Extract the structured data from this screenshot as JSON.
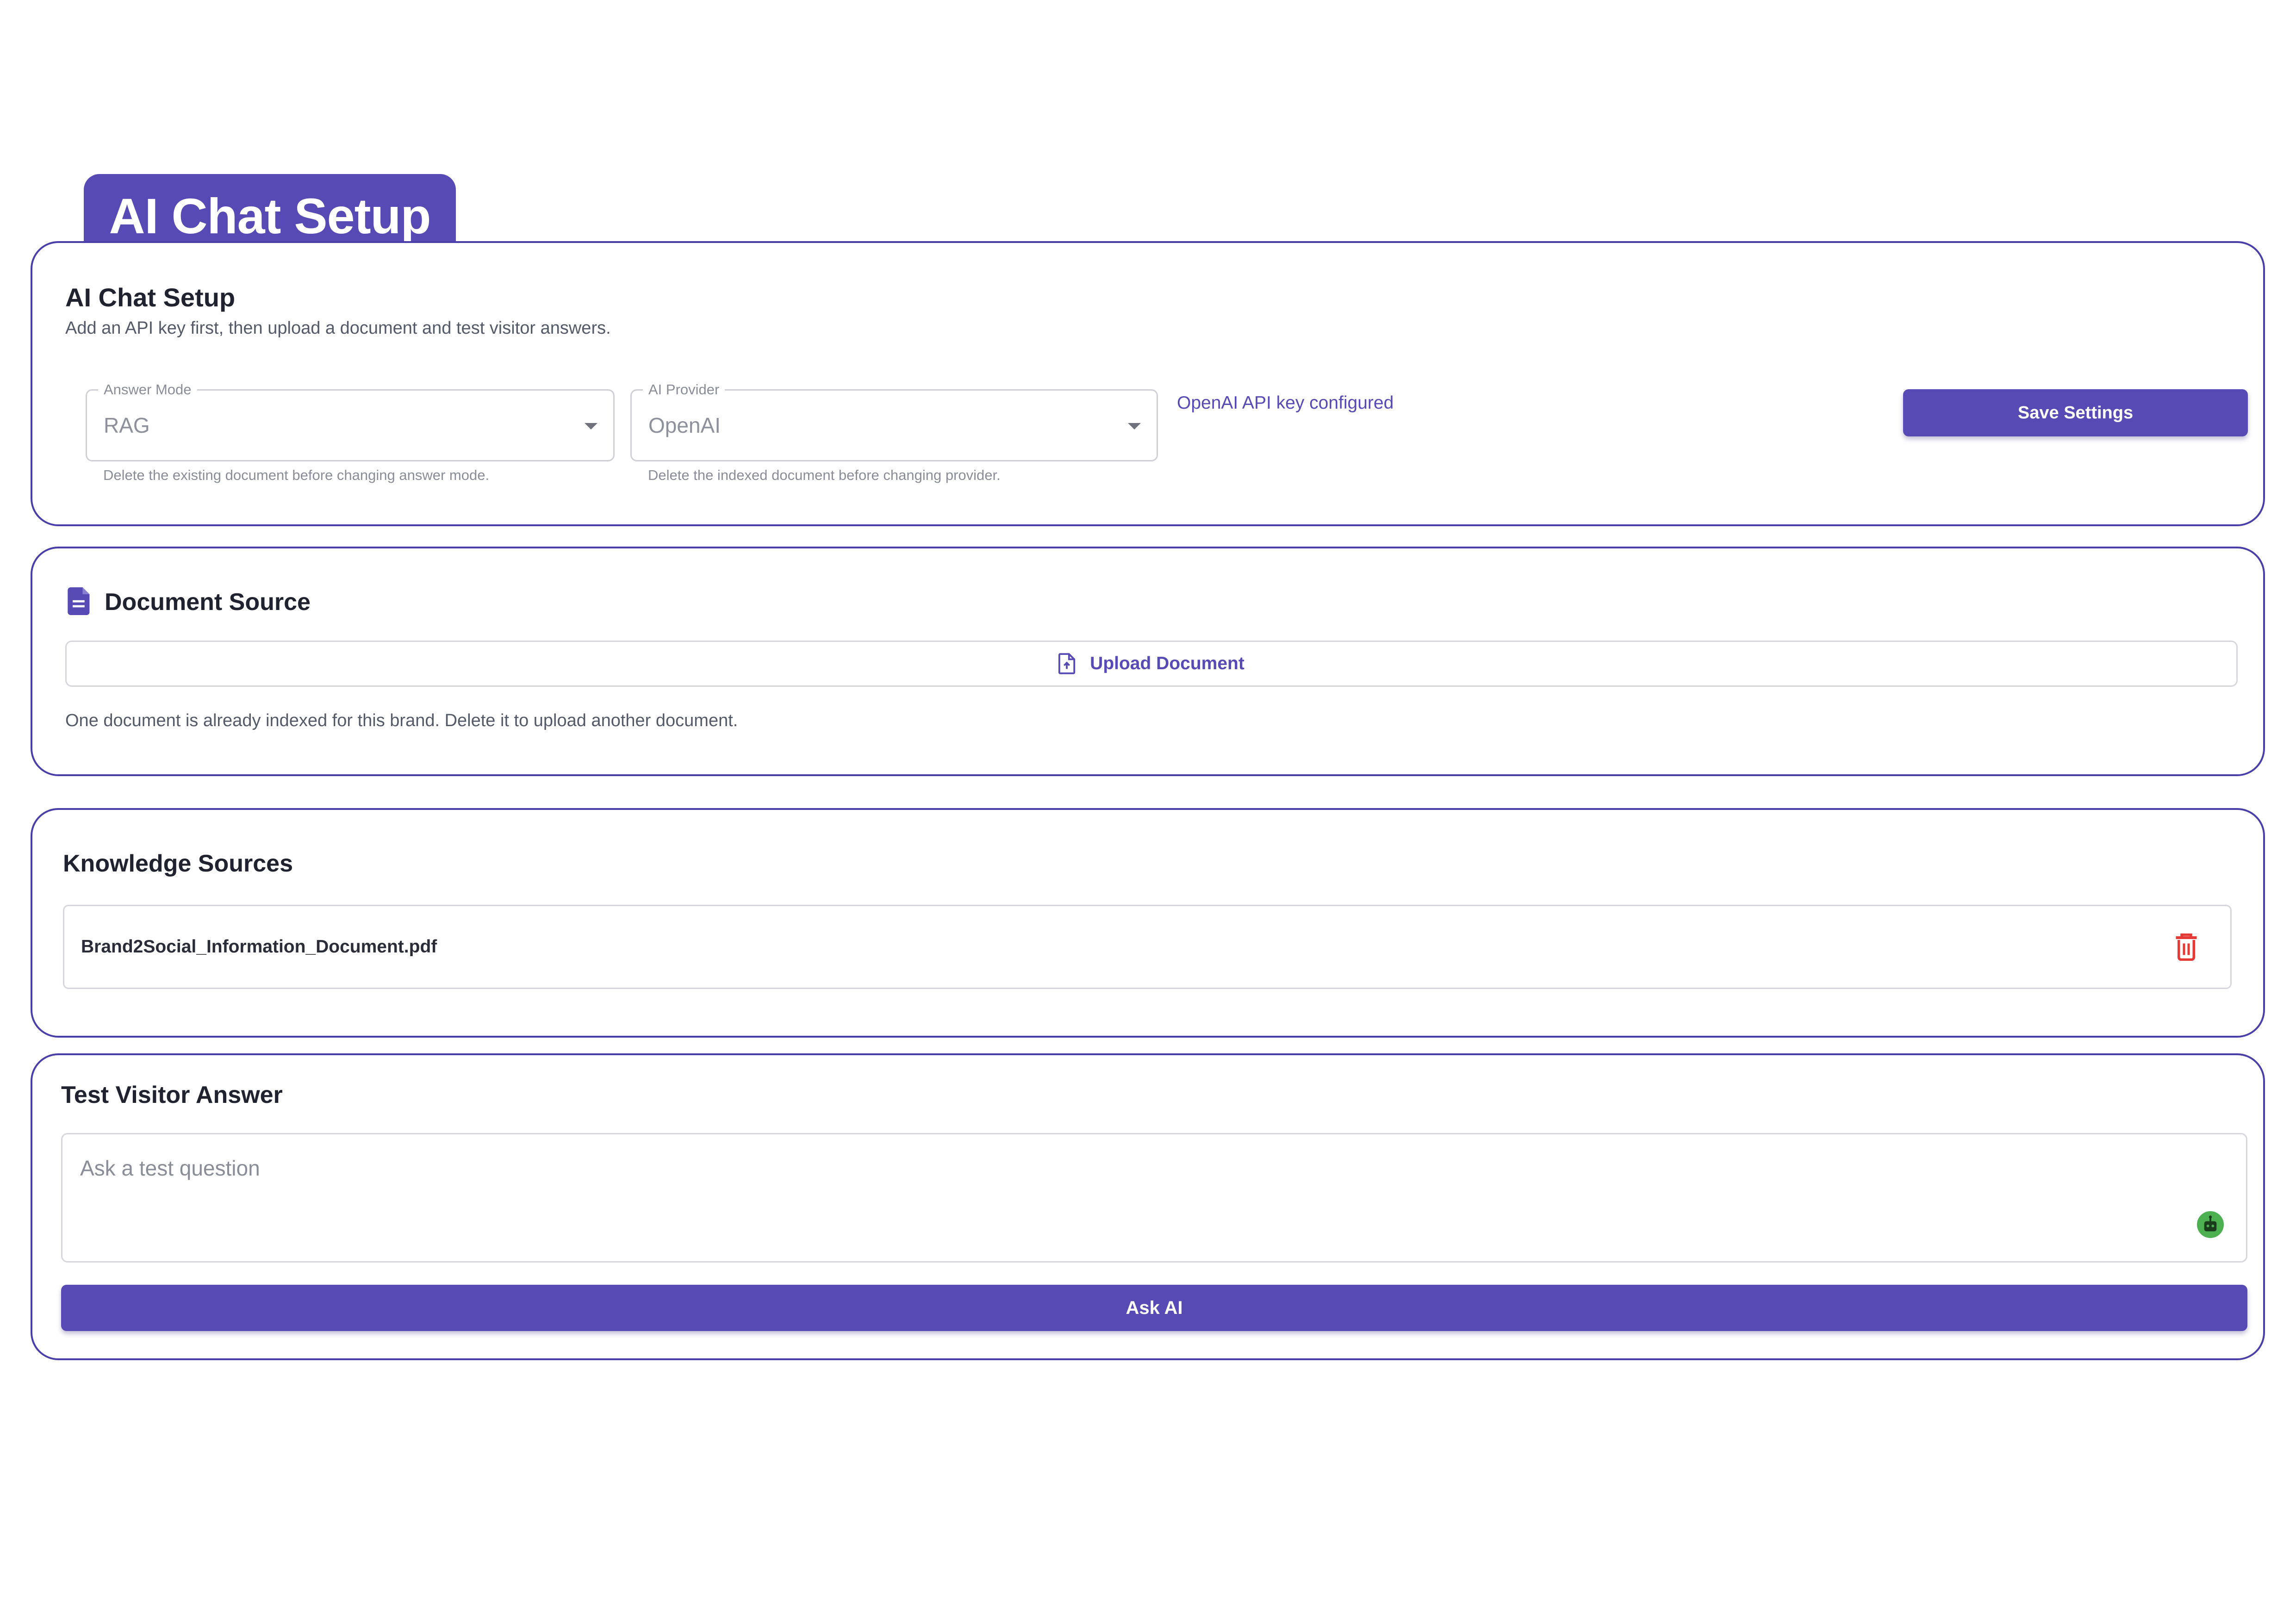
{
  "page_tab": {
    "title": "AI Chat Setup"
  },
  "setup": {
    "title": "AI Chat Setup",
    "subtitle": "Add an API key first, then upload a document and test visitor answers.",
    "answer_mode": {
      "label": "Answer Mode",
      "value": "RAG",
      "help": "Delete the existing document before changing answer mode."
    },
    "ai_provider": {
      "label": "AI Provider",
      "value": "OpenAI",
      "help": "Delete the indexed document before changing provider."
    },
    "key_status": "OpenAI API key configured",
    "save_label": "Save Settings"
  },
  "document_source": {
    "title": "Document Source",
    "icon": "document-icon",
    "upload_label": "Upload Document",
    "upload_icon": "upload-file-icon",
    "note": "One document is already indexed for this brand. Delete it to upload another document."
  },
  "knowledge_sources": {
    "title": "Knowledge Sources",
    "items": [
      {
        "name": "Brand2Social_Information_Document.pdf",
        "action_icon": "trash-icon"
      }
    ]
  },
  "test_visitor": {
    "title": "Test Visitor Answer",
    "placeholder": "Ask a test question",
    "assistant_icon": "bot-icon",
    "ask_label": "Ask AI"
  },
  "colors": {
    "accent": "#574ab4",
    "border": "#4a3fa8",
    "danger": "#e53935",
    "bot_badge": "#4caf50"
  }
}
